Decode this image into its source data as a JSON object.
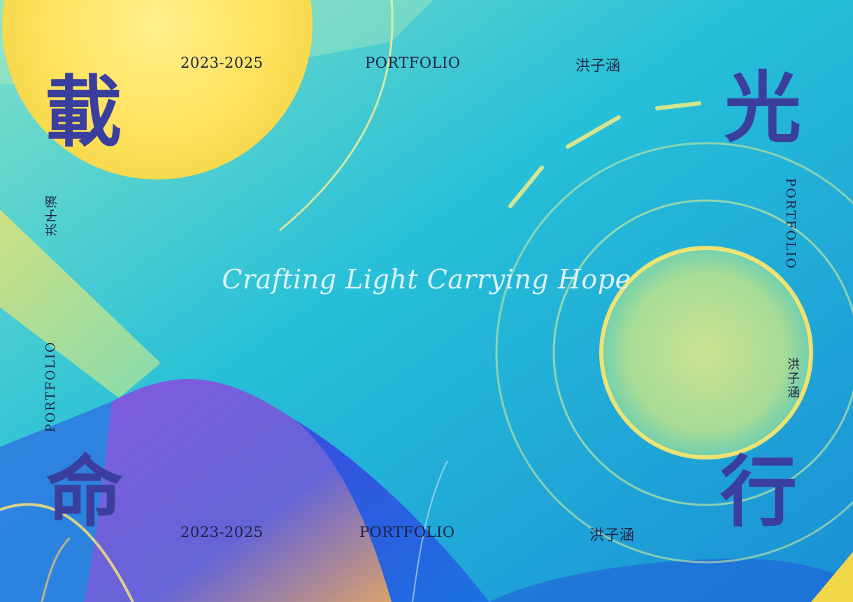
{
  "header": {
    "years": "2023-2025",
    "portfolio": "PORTFOLIO",
    "author": "洪子涵"
  },
  "footer": {
    "years": "2023-2025",
    "portfolio": "PORTFOLIO",
    "author": "洪子涵"
  },
  "left_side": {
    "author": "洪子涵",
    "portfolio": "PORTFOLIO"
  },
  "right_side": {
    "portfolio": "PORTFOLIO",
    "author": "洪子涵"
  },
  "corner_chars": {
    "top_left": "載",
    "top_right": "光",
    "bottom_left": "命",
    "bottom_right": "行"
  },
  "tagline": "Crafting Light Carrying Hope",
  "colors": {
    "sky_cyan": "#1fb3d4",
    "sun_yellow": "#ffe05a",
    "violet": "#7b4fd6",
    "deep_blue": "#2a4fd0",
    "ink": "#3a3f9e"
  }
}
